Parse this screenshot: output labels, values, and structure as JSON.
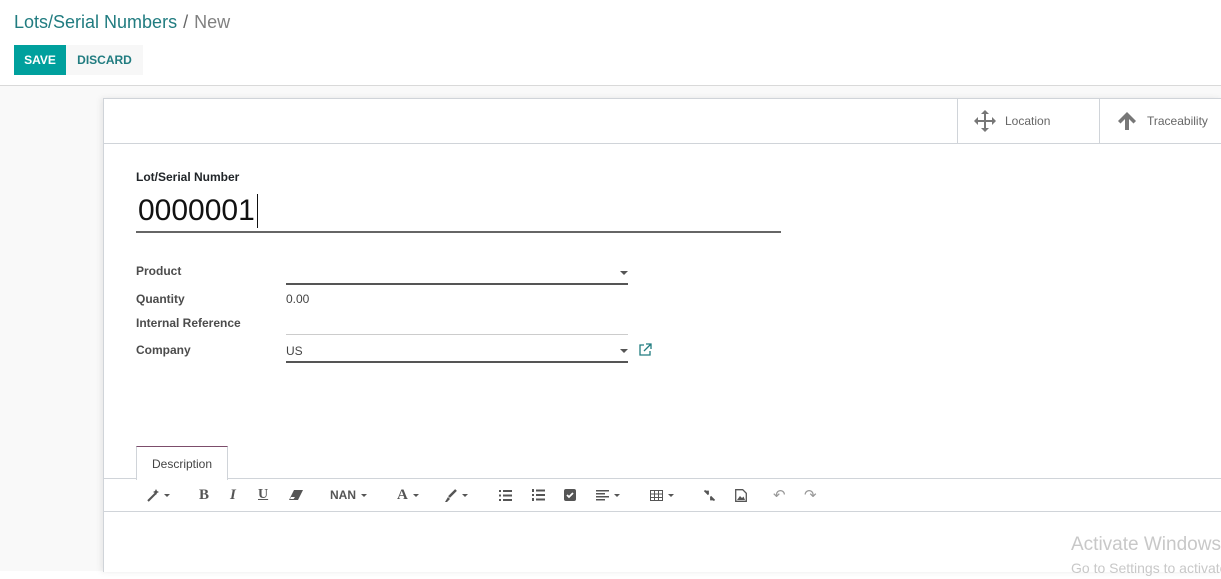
{
  "breadcrumb": {
    "parent": "Lots/Serial Numbers",
    "separator": "/",
    "current": "New"
  },
  "toolbar": {
    "save_label": "SAVE",
    "discard_label": "DISCARD"
  },
  "smart_buttons": [
    {
      "label": "Location",
      "icon": "arrows-move-icon"
    },
    {
      "label": "Traceability",
      "icon": "arrow-up-icon"
    }
  ],
  "form": {
    "lot_label": "Lot/Serial Number",
    "lot_value": "0000001",
    "fields": {
      "product": {
        "label": "Product",
        "value": ""
      },
      "quantity": {
        "label": "Quantity",
        "value": "0.00"
      },
      "internal_reference": {
        "label": "Internal Reference",
        "value": ""
      },
      "company": {
        "label": "Company",
        "value": "US"
      }
    }
  },
  "notebook": {
    "tabs": [
      {
        "label": "Description",
        "active": true
      }
    ]
  },
  "editor_toolbar": {
    "font_size_label": "NAN"
  },
  "watermark": {
    "title": "Activate Windows",
    "subtitle": "Go to Settings to activate Windows."
  },
  "colors": {
    "primary": "#00a09d",
    "link": "#217c80"
  }
}
